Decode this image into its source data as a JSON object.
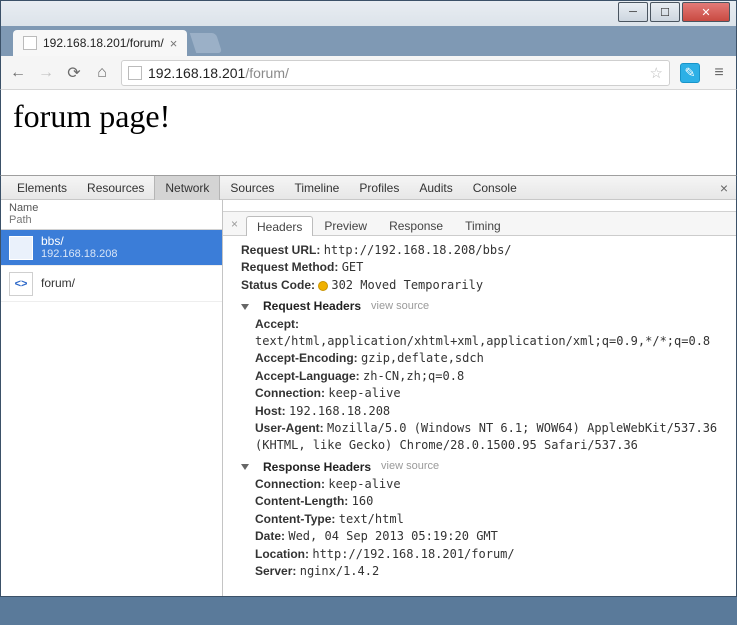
{
  "window": {
    "tab_title": "192.168.18.201/forum/"
  },
  "address": {
    "host": "192.168.18.201",
    "path": "/forum/"
  },
  "page": {
    "heading": "forum page!"
  },
  "devtools": {
    "tabs": [
      "Elements",
      "Resources",
      "Network",
      "Sources",
      "Timeline",
      "Profiles",
      "Audits",
      "Console"
    ],
    "active_tab": "Network",
    "left": {
      "col_name": "Name",
      "col_path": "Path",
      "requests": [
        {
          "name": "bbs/",
          "sub": "192.168.18.208",
          "type": "doc",
          "selected": true
        },
        {
          "name": "forum/",
          "sub": "",
          "type": "html",
          "selected": false
        }
      ]
    },
    "right": {
      "subtabs": [
        "Headers",
        "Preview",
        "Response",
        "Timing"
      ],
      "active_subtab": "Headers",
      "general": {
        "request_url_label": "Request URL:",
        "request_url": "http://192.168.18.208/bbs/",
        "request_method_label": "Request Method:",
        "request_method": "GET",
        "status_code_label": "Status Code:",
        "status_code": "302 Moved Temporarily"
      },
      "request_headers_label": "Request Headers",
      "view_source": "view source",
      "request_headers": {
        "Accept": "text/html,application/xhtml+xml,application/xml;q=0.9,*/*;q=0.8",
        "Accept-Encoding": "gzip,deflate,sdch",
        "Accept-Language": "zh-CN,zh;q=0.8",
        "Connection": "keep-alive",
        "Host": "192.168.18.208",
        "User-Agent": "Mozilla/5.0 (Windows NT 6.1; WOW64) AppleWebKit/537.36 (KHTML, like Gecko) Chrome/28.0.1500.95 Safari/537.36"
      },
      "response_headers_label": "Response Headers",
      "response_headers": {
        "Connection": "keep-alive",
        "Content-Length": "160",
        "Content-Type": "text/html",
        "Date": "Wed, 04 Sep 2013 05:19:20 GMT",
        "Location": "http://192.168.18.201/forum/",
        "Server": "nginx/1.4.2"
      }
    }
  }
}
